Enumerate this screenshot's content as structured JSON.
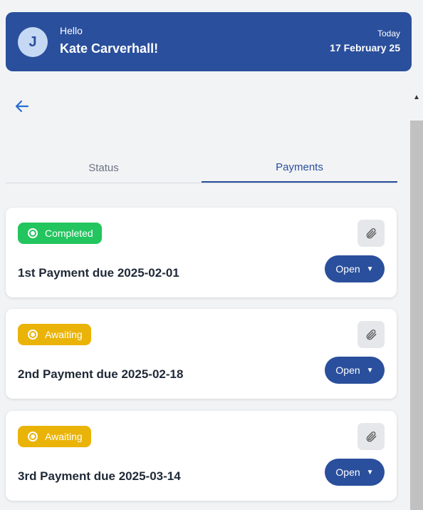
{
  "header": {
    "avatar_initial": "J",
    "greeting": "Hello",
    "user_name": "Kate Carverhall!",
    "today_label": "Today",
    "today_date": "17 February 25"
  },
  "tabs": [
    {
      "label": "Status",
      "active": false
    },
    {
      "label": "Payments",
      "active": true
    }
  ],
  "payments": [
    {
      "status": "Completed",
      "title": "1st Payment due 2025-02-01",
      "action": "Open"
    },
    {
      "status": "Awaiting",
      "title": "2nd Payment due 2025-02-18",
      "action": "Open"
    },
    {
      "status": "Awaiting",
      "title": "3rd Payment due 2025-03-14",
      "action": "Open"
    }
  ],
  "colors": {
    "primary": "#2a4f9c",
    "completed": "#22c55e",
    "awaiting": "#eab308",
    "background": "#f2f3f5"
  },
  "icons": {
    "back": "arrow-left-icon",
    "attach": "paperclip-icon",
    "dropdown": "caret-down-icon",
    "status": "radio-dot-icon"
  }
}
